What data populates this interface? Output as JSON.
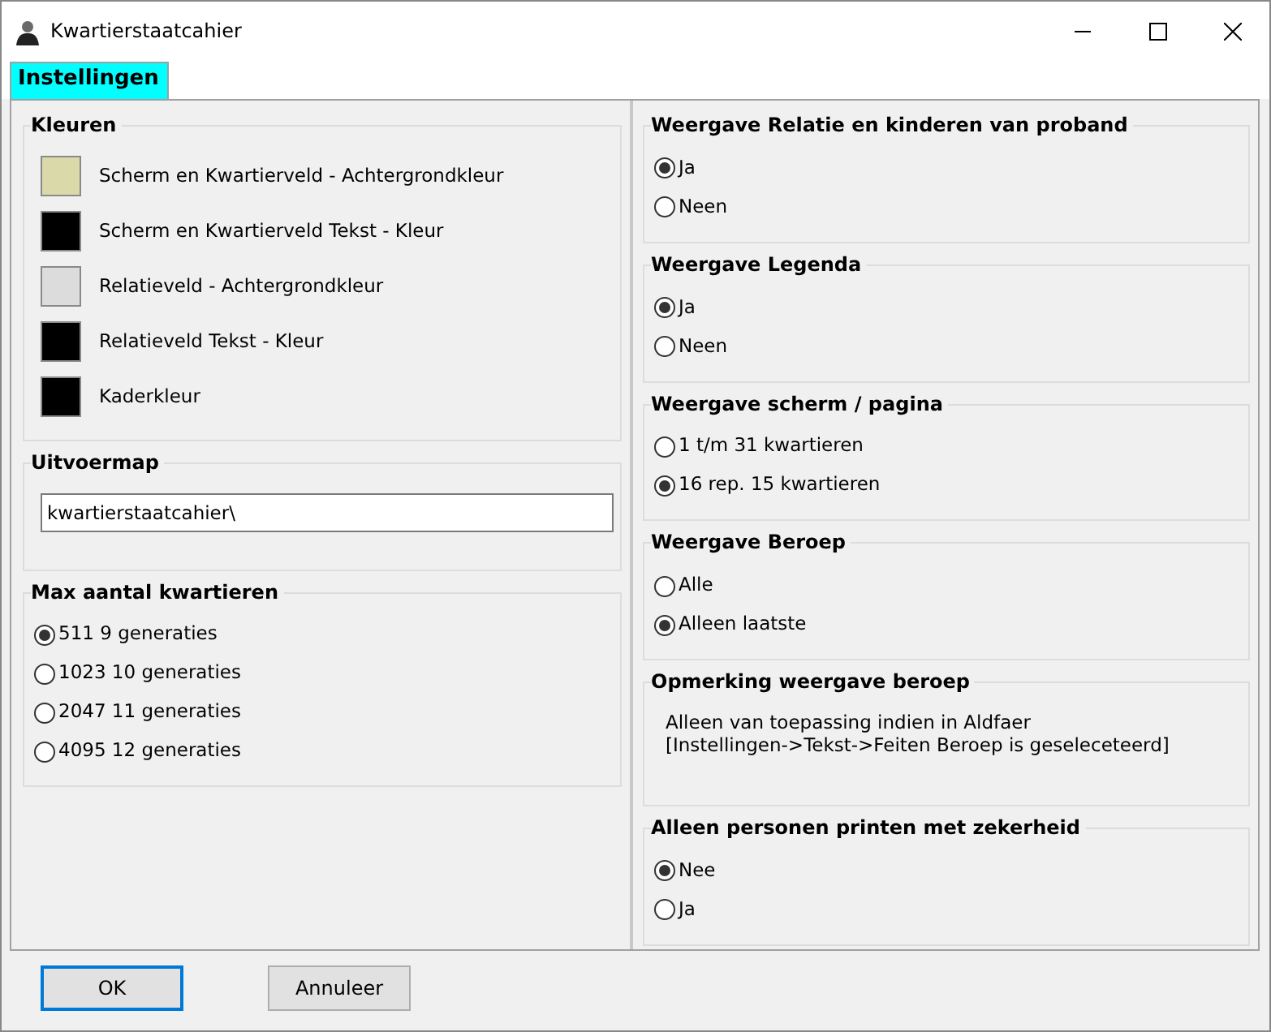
{
  "window": {
    "title": "Kwartierstaatcahier"
  },
  "tabs": [
    {
      "label": "Instellingen",
      "selected": true
    }
  ],
  "columns": [
    [
      {
        "kind": "colors",
        "title": "Kleuren",
        "items": [
          {
            "label": "Scherm en Kwartierveld - Achtergrondkleur",
            "color": "#d9d9a9"
          },
          {
            "label": "Scherm en Kwartierveld Tekst - Kleur",
            "color": "#000000"
          },
          {
            "label": "Relatieveld - Achtergrondkleur",
            "color": "#dcdcdc"
          },
          {
            "label": "Relatieveld Tekst - Kleur",
            "color": "#000000"
          },
          {
            "label": "Kaderkleur",
            "color": "#000000"
          }
        ]
      },
      {
        "kind": "input",
        "title": "Uitvoermap",
        "value": "kwartierstaatcahier\\"
      },
      {
        "kind": "radios",
        "title": "Max aantal kwartieren",
        "options": [
          {
            "label": "511 9 generaties",
            "selected": true
          },
          {
            "label": "1023 10 generaties",
            "selected": false
          },
          {
            "label": "2047 11 generaties",
            "selected": false
          },
          {
            "label": "4095 12 generaties",
            "selected": false
          }
        ]
      }
    ],
    [
      {
        "kind": "radios",
        "title": "Weergave Relatie en kinderen van proband",
        "options": [
          {
            "label": "Ja",
            "selected": true
          },
          {
            "label": "Neen",
            "selected": false
          }
        ]
      },
      {
        "kind": "radios",
        "title": "Weergave Legenda",
        "options": [
          {
            "label": "Ja",
            "selected": true
          },
          {
            "label": "Neen",
            "selected": false
          }
        ]
      },
      {
        "kind": "radios",
        "title": "Weergave scherm / pagina",
        "options": [
          {
            "label": "1 t/m 31 kwartieren",
            "selected": false
          },
          {
            "label": "16 rep. 15 kwartieren",
            "selected": true
          }
        ]
      },
      {
        "kind": "radios",
        "title": "Weergave Beroep",
        "options": [
          {
            "label": "Alle",
            "selected": false
          },
          {
            "label": "Alleen laatste",
            "selected": true
          }
        ]
      },
      {
        "kind": "note",
        "title": "Opmerking weergave beroep",
        "lines": [
          "Alleen van toepassing indien in Aldfaer",
          "[Instellingen->Tekst->Feiten Beroep is geseleceteerd]"
        ]
      },
      {
        "kind": "radios",
        "title": "Alleen personen printen met zekerheid",
        "options": [
          {
            "label": "Nee",
            "selected": true
          },
          {
            "label": "Ja",
            "selected": false
          }
        ]
      }
    ]
  ],
  "buttons": [
    {
      "label": "OK",
      "focused": true
    },
    {
      "label": "Annuleer",
      "focused": false
    }
  ]
}
